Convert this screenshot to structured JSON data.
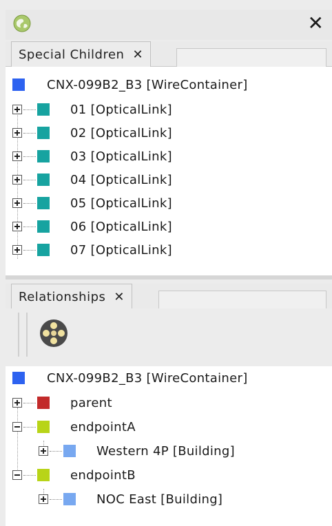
{
  "window": {
    "close_glyph": "✕"
  },
  "special_children": {
    "tab_label": "Special Children",
    "tab_close": "✕",
    "root": {
      "label": "CNX-099B2_B3 [WireContainer]",
      "color": "#2d62f0"
    },
    "items": [
      {
        "label": "01 [OpticalLink]",
        "color": "#17a3a0"
      },
      {
        "label": "02 [OpticalLink]",
        "color": "#17a3a0"
      },
      {
        "label": "03 [OpticalLink]",
        "color": "#17a3a0"
      },
      {
        "label": "04 [OpticalLink]",
        "color": "#17a3a0"
      },
      {
        "label": "05 [OpticalLink]",
        "color": "#17a3a0"
      },
      {
        "label": "06 [OpticalLink]",
        "color": "#17a3a0"
      },
      {
        "label": "07 [OpticalLink]",
        "color": "#17a3a0"
      }
    ]
  },
  "relationships": {
    "tab_label": "Relationships",
    "tab_close": "✕",
    "root": {
      "label": "CNX-099B2_B3 [WireContainer]",
      "color": "#2d62f0"
    },
    "parent": {
      "label": "parent",
      "color": "#c22a2a"
    },
    "endpointA": {
      "label": "endpointA",
      "color": "#b8d418"
    },
    "endpointA_child": {
      "label": "Western 4P [Building]",
      "color": "#78a8f0"
    },
    "endpointB": {
      "label": "endpointB",
      "color": "#b8d418"
    },
    "endpointB_child": {
      "label": "NOC East [Building]",
      "color": "#78a8f0"
    }
  }
}
